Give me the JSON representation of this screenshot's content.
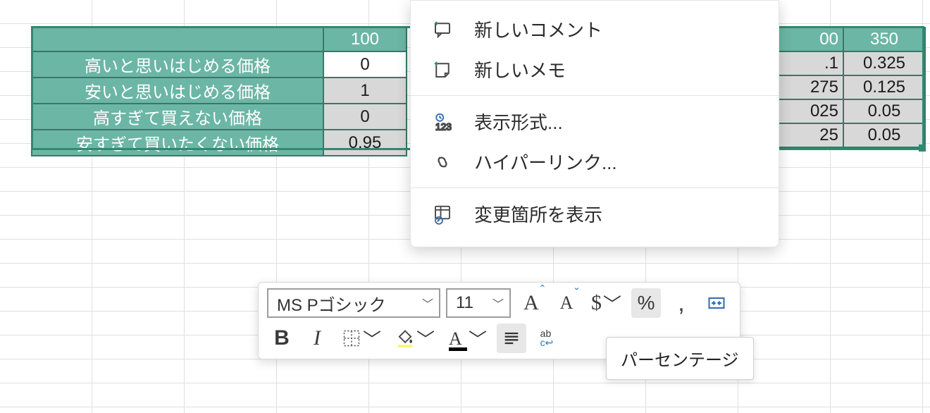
{
  "table": {
    "header_values": [
      "100",
      "00",
      "350"
    ],
    "rows": [
      {
        "label": "高いと思いはじめる価格",
        "c0": "0",
        "c_right1": ".1",
        "c_right2": "0.325",
        "c0_bg": "white"
      },
      {
        "label": "安いと思いはじめる価格",
        "c0": "1",
        "c_right1": "275",
        "c_right2": "0.125",
        "c0_bg": "grey"
      },
      {
        "label": "高すぎて買えない価格",
        "c0": "0",
        "c_right1": "025",
        "c_right2": "0.05",
        "c0_bg": "grey"
      },
      {
        "label": "安すぎて買いたくない価格",
        "c0": "0.95",
        "c_right1": "25",
        "c_right2": "0.05",
        "c0_bg": "grey"
      }
    ]
  },
  "context_menu": {
    "new_comment": "新しいコメント",
    "new_memo": "新しいメモ",
    "format_cells": "表示形式...",
    "hyperlink": "ハイパーリンク...",
    "show_changes": "変更箇所を表示"
  },
  "minibar": {
    "font_name": "MS Pゴシック",
    "font_size": "11",
    "tooltip_percentage": "パーセンテージ"
  }
}
